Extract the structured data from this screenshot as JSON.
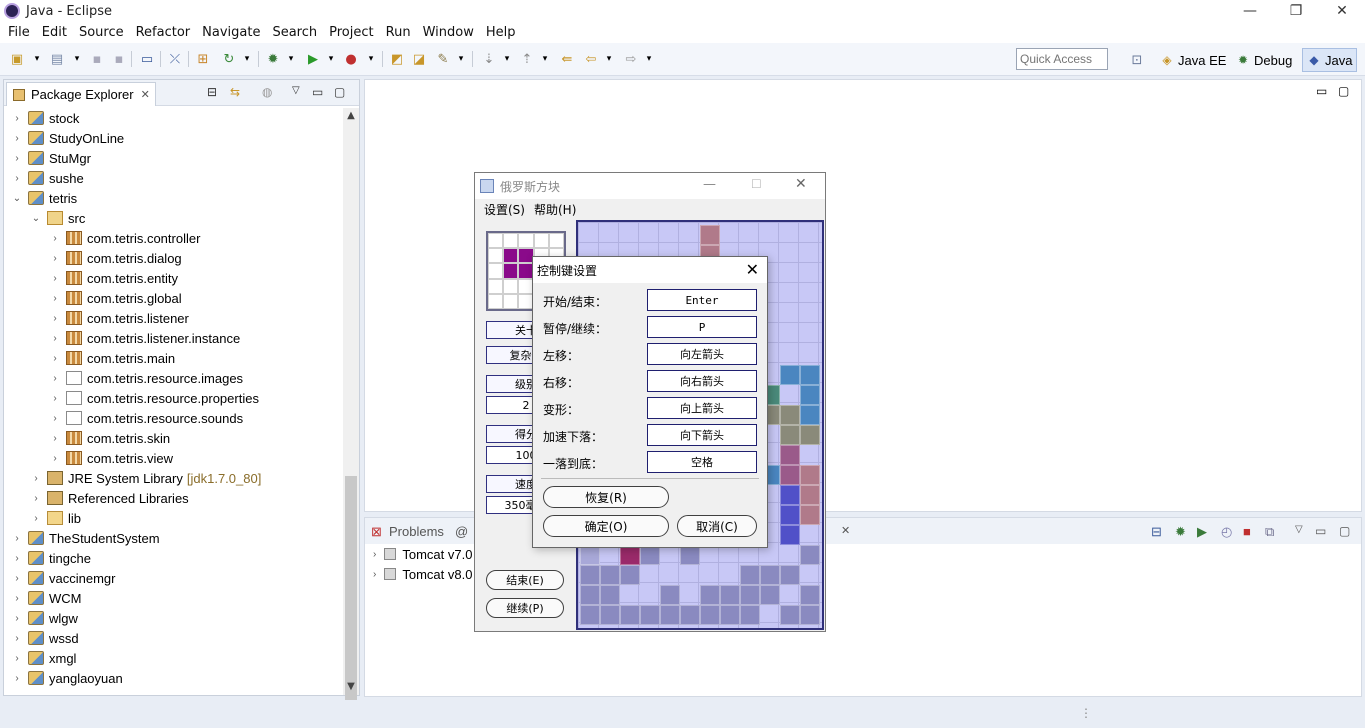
{
  "window": {
    "title": "Java - Eclipse"
  },
  "menu": [
    "File",
    "Edit",
    "Source",
    "Refactor",
    "Navigate",
    "Search",
    "Project",
    "Run",
    "Window",
    "Help"
  ],
  "quick_access": {
    "placeholder": "Quick Access"
  },
  "perspectives": [
    {
      "label": "Java EE",
      "active": false
    },
    {
      "label": "Debug",
      "active": false
    },
    {
      "label": "Java",
      "active": true
    }
  ],
  "package_explorer": {
    "tab_label": "Package Explorer",
    "tree": [
      {
        "label": "stock",
        "kind": "project",
        "level": 0,
        "expanded": false
      },
      {
        "label": "StudyOnLine",
        "kind": "project",
        "level": 0,
        "expanded": false
      },
      {
        "label": "StuMgr",
        "kind": "project",
        "level": 0,
        "expanded": false
      },
      {
        "label": "sushe",
        "kind": "project",
        "level": 0,
        "expanded": false
      },
      {
        "label": "tetris",
        "kind": "project",
        "level": 0,
        "expanded": true
      },
      {
        "label": "src",
        "kind": "src",
        "level": 1,
        "expanded": true
      },
      {
        "label": "com.tetris.controller",
        "kind": "package",
        "level": 2,
        "expanded": false
      },
      {
        "label": "com.tetris.dialog",
        "kind": "package",
        "level": 2,
        "expanded": false
      },
      {
        "label": "com.tetris.entity",
        "kind": "package",
        "level": 2,
        "expanded": false
      },
      {
        "label": "com.tetris.global",
        "kind": "package",
        "level": 2,
        "expanded": false
      },
      {
        "label": "com.tetris.listener",
        "kind": "package",
        "level": 2,
        "expanded": false
      },
      {
        "label": "com.tetris.listener.instance",
        "kind": "package",
        "level": 2,
        "expanded": false
      },
      {
        "label": "com.tetris.main",
        "kind": "package",
        "level": 2,
        "expanded": false
      },
      {
        "label": "com.tetris.resource.images",
        "kind": "package-empty",
        "level": 2,
        "expanded": false
      },
      {
        "label": "com.tetris.resource.properties",
        "kind": "package-empty",
        "level": 2,
        "expanded": false
      },
      {
        "label": "com.tetris.resource.sounds",
        "kind": "package-empty",
        "level": 2,
        "expanded": false
      },
      {
        "label": "com.tetris.skin",
        "kind": "package",
        "level": 2,
        "expanded": false
      },
      {
        "label": "com.tetris.view",
        "kind": "package",
        "level": 2,
        "expanded": false
      },
      {
        "label": "JRE System Library",
        "decoration": "[jdk1.7.0_80]",
        "kind": "library",
        "level": 1,
        "expanded": false
      },
      {
        "label": "Referenced Libraries",
        "kind": "library",
        "level": 1,
        "expanded": false
      },
      {
        "label": "lib",
        "kind": "folder",
        "level": 1,
        "expanded": false
      },
      {
        "label": "TheStudentSystem",
        "kind": "project",
        "level": 0,
        "expanded": false
      },
      {
        "label": "tingche",
        "kind": "project",
        "level": 0,
        "expanded": false
      },
      {
        "label": "vaccinemgr",
        "kind": "project",
        "level": 0,
        "expanded": false
      },
      {
        "label": "WCM",
        "kind": "project",
        "level": 0,
        "expanded": false
      },
      {
        "label": "wlgw",
        "kind": "project",
        "level": 0,
        "expanded": false
      },
      {
        "label": "wssd",
        "kind": "project",
        "level": 0,
        "expanded": false
      },
      {
        "label": "xmgl",
        "kind": "project",
        "level": 0,
        "expanded": false
      },
      {
        "label": "yanglaoyuan",
        "kind": "project",
        "level": 0,
        "expanded": false
      }
    ]
  },
  "bottom_panel": {
    "tab_problems": "Problems",
    "tab_at": "@",
    "tab_servers_tail": "rs",
    "rows": [
      "Tomcat v7.0",
      "Tomcat v8.0"
    ]
  },
  "tetris_window": {
    "title": "俄罗斯方块",
    "menu": [
      "设置(S)",
      "帮助(H)"
    ],
    "left_buttons": {
      "level_btn": "关卡",
      "complexity_btn": "复杂性",
      "grade_btn": "级别",
      "grade_value": "2",
      "score_btn": "得分",
      "score_value": "100",
      "speed_btn": "速度",
      "speed_value": "350毫秒",
      "end_btn": "结束(E)",
      "continue_btn": "继续(P)"
    },
    "preview_filled": [
      6,
      7,
      11,
      12
    ]
  },
  "key_dialog": {
    "title": "控制键设置",
    "rows": [
      {
        "label": "开始/结束：",
        "value": "Enter"
      },
      {
        "label": "暂停/继续：",
        "value": "P"
      },
      {
        "label": "左移：",
        "value": "向左箭头"
      },
      {
        "label": "右移：",
        "value": "向右箭头"
      },
      {
        "label": "变形：",
        "value": "向上箭头"
      },
      {
        "label": "加速下落：",
        "value": "向下箭头"
      },
      {
        "label": "一落到底：",
        "value": "空格"
      }
    ],
    "restore_label": "恢复(R)",
    "ok_label": "确定(O)",
    "cancel_label": "取消(C)"
  },
  "colors": {
    "board_bg": "#c8c8f6",
    "preview_block": "#8a0a8a",
    "dialog_value_border": "#1f1f6f"
  }
}
